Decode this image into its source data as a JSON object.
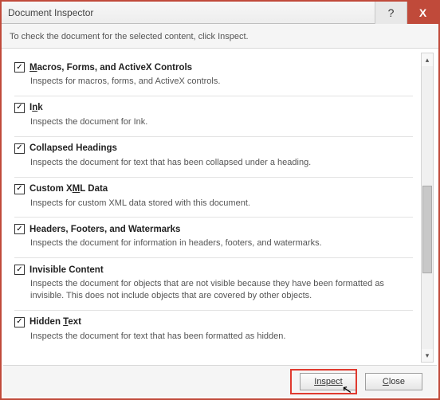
{
  "window": {
    "title": "Document Inspector",
    "help_label": "?",
    "close_label": "X"
  },
  "instruction": "To check the document for the selected content, click Inspect.",
  "items": [
    {
      "checked": true,
      "title_html": "<span class='ul'>M</span>acros, Forms, and ActiveX Controls",
      "desc": "Inspects for macros, forms, and ActiveX controls."
    },
    {
      "checked": true,
      "title_html": "I<span class='ul'>n</span>k",
      "desc": "Inspects the document for Ink."
    },
    {
      "checked": true,
      "title_html": "Collapsed Headings",
      "desc": "Inspects the document for text that has been collapsed under a heading."
    },
    {
      "checked": true,
      "title_html": "Custom X<span class='ul'>M</span>L Data",
      "desc": "Inspects for custom XML data stored with this document."
    },
    {
      "checked": true,
      "title_html": "Headers, Footers, and Watermarks",
      "desc": "Inspects the document for information in headers, footers, and watermarks."
    },
    {
      "checked": true,
      "title_html": "Invisible Content",
      "desc": "Inspects the document for objects that are not visible because they have been formatted as invisible. This does not include objects that are covered by other objects."
    },
    {
      "checked": true,
      "title_html": "Hidden <span class='ul'>T</span>ext",
      "desc": "Inspects the document for text that has been formatted as hidden."
    }
  ],
  "buttons": {
    "inspect": "Inspect",
    "close": "Close"
  },
  "scrollbar": {
    "up": "▴",
    "down": "▾"
  }
}
